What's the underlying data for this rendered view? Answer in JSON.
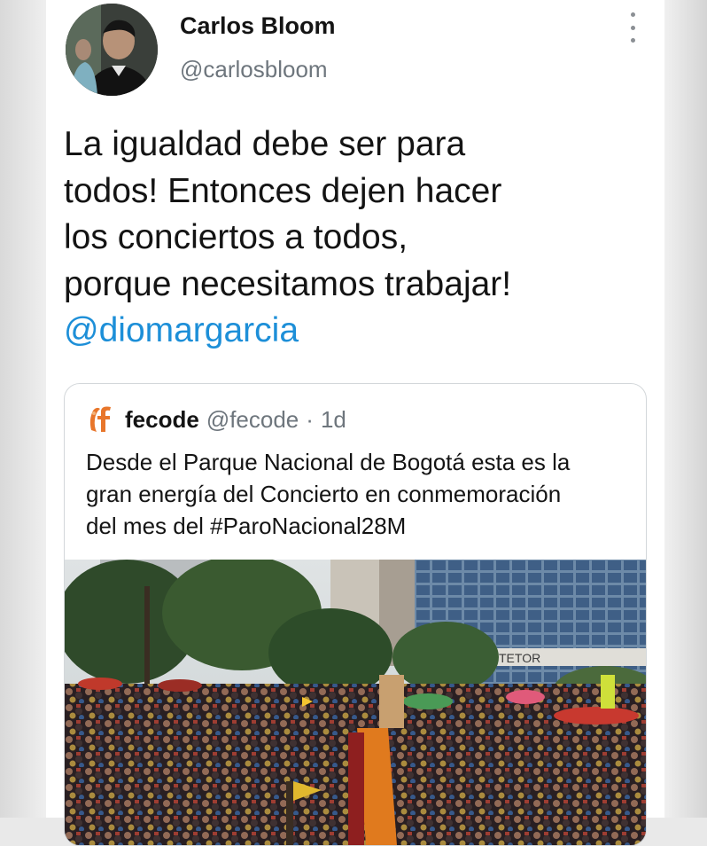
{
  "tweet": {
    "author": {
      "name": "Carlos Bloom",
      "handle": "@carlosbloom",
      "avatar_icon": "profile-photo-icon"
    },
    "menu_icon": "more-vertical-icon",
    "text_lines": [
      "La igualdad debe ser para",
      "todos! Entonces dejen hacer",
      "los conciertos a todos,",
      "porque necesitamos trabajar!"
    ],
    "mention": "@diomargarcia",
    "link_color": "#1d8fd8"
  },
  "quoted_tweet": {
    "name": "fecode",
    "handle": "@fecode",
    "separator": "·",
    "time": "1d",
    "logo_icon": "fecode-logo-icon",
    "logo_color": "#e8762b",
    "text_lines": [
      "Desde el Parque Nacional de Bogotá esta es la",
      "gran energía del Concierto en conmemoración",
      "del mes del #ParoNacional28M"
    ],
    "media_icon": "concert-crowd-photo-icon"
  }
}
